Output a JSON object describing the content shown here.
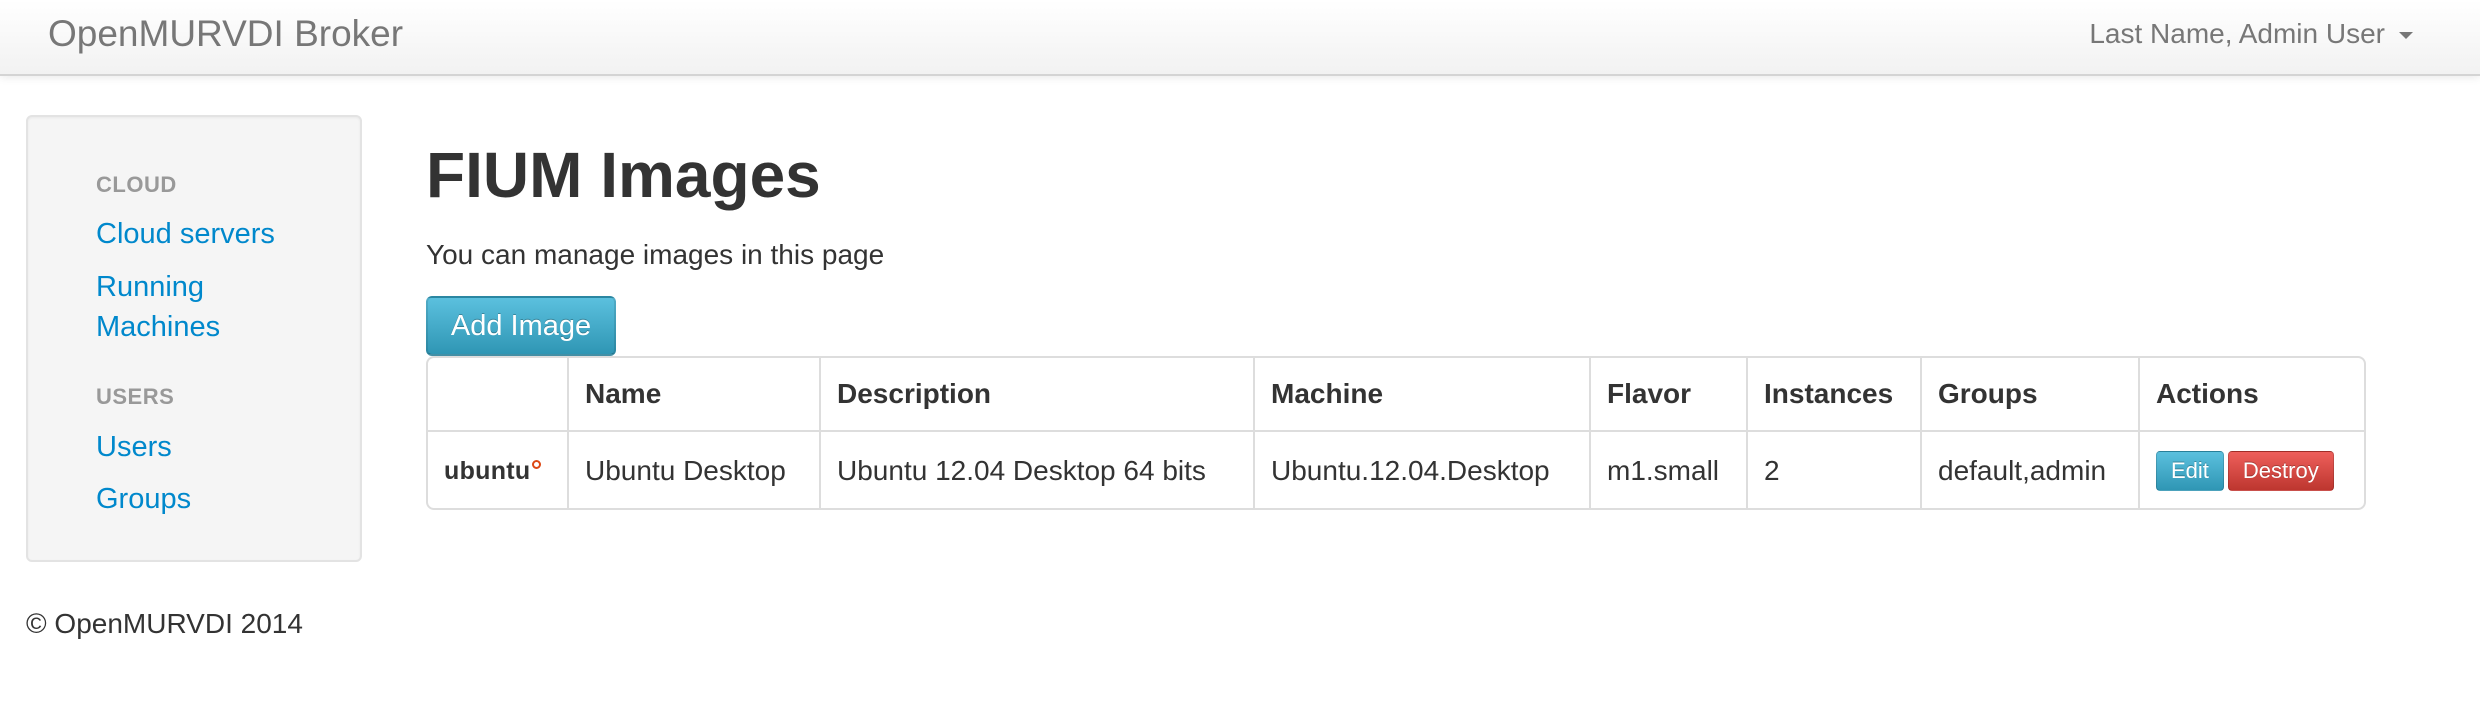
{
  "navbar": {
    "brand": "OpenMURVDI Broker",
    "user_menu": "Last Name, Admin User"
  },
  "sidebar": {
    "sections": [
      {
        "header": "CLOUD",
        "items": [
          "Cloud servers",
          "Running",
          "Machines"
        ]
      },
      {
        "header": "USERS",
        "items": [
          "Users",
          "Groups"
        ]
      }
    ]
  },
  "main": {
    "title": "FIUM Images",
    "subtitle": "You can manage images in this page",
    "add_button": "Add Image",
    "table": {
      "columns": [
        "",
        "Name",
        "Description",
        "Machine",
        "Flavor",
        "Instances",
        "Groups",
        "Actions"
      ],
      "rows": [
        {
          "logo_text": "ubuntu",
          "name": "Ubuntu Desktop",
          "description": "Ubuntu 12.04 Desktop 64 bits",
          "machine": "Ubuntu.12.04.Desktop",
          "flavor": "m1.small",
          "instances": "2",
          "groups": "default,admin",
          "edit_label": "Edit",
          "destroy_label": "Destroy"
        }
      ]
    }
  },
  "footer": {
    "text": "© OpenMURVDI 2014"
  },
  "colors": {
    "link": "#0088cc",
    "info_button": "#49afcd",
    "danger_button": "#da4f49",
    "ubuntu_orange": "#dd4814"
  }
}
